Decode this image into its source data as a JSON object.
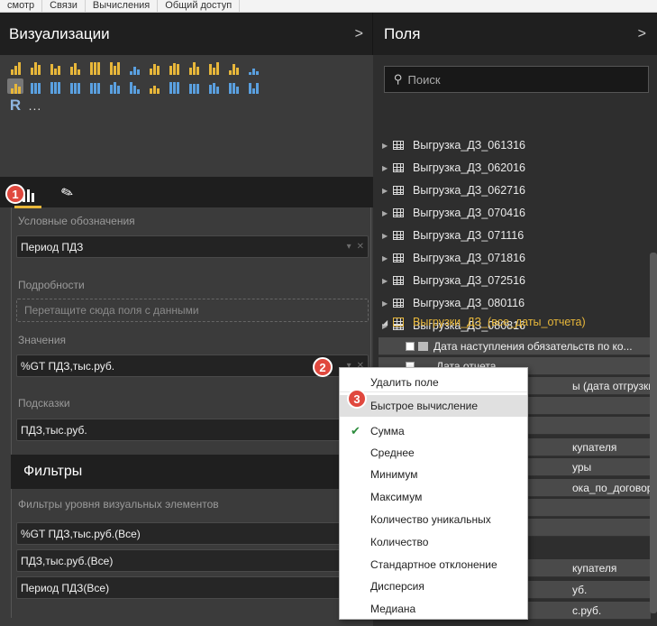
{
  "ribbon": {
    "items": [
      "смотр",
      "Связи",
      "Вычисления",
      "Общий доступ"
    ]
  },
  "viz": {
    "title": "Визуализации",
    "chevron": ">",
    "r_label": "R",
    "more_label": "...",
    "tabs": {
      "fields_badge": "1"
    },
    "wells": {
      "legend_label": "Условные обозначения",
      "legend_value": "Период ПДЗ",
      "details_label": "Подробности",
      "details_placeholder": "Перетащите сюда поля с данными",
      "values_label": "Значения",
      "values_value": "%GT ПДЗ,тыс.руб.",
      "values_badge": "2",
      "tooltips_label": "Подсказки",
      "tooltips_value": "ПДЗ,тыс.руб."
    },
    "filters": {
      "title": "Фильтры",
      "level_label": "Фильтры уровня визуальных элементов",
      "items": [
        "%GT ПДЗ,тыс.руб.(Все)",
        "ПДЗ,тыс.руб.(Все)",
        "Период ПДЗ(Все)"
      ]
    },
    "well_controls": {
      "dropdown": "▾",
      "remove": "✕"
    }
  },
  "fields": {
    "title": "Поля",
    "chevron": ">",
    "search_placeholder": "Поиск",
    "tables": [
      "Выгрузка_ДЗ_061316",
      "Выгрузка_ДЗ_062016",
      "Выгрузка_ДЗ_062716",
      "Выгрузка_ДЗ_070416",
      "Выгрузка_ДЗ_071116",
      "Выгрузка_ДЗ_071816",
      "Выгрузка_ДЗ_072516",
      "Выгрузка_ДЗ_080116",
      "Выгрузка_ДЗ_080816"
    ],
    "open_table": "Выгрузки_ДЗ_(все_даты_отчета)",
    "field_rows": [
      "Дата наступления обязательств по ко...",
      "Дата отчета",
      "ы (дата отгрузки)",
      "",
      "",
      "купателя",
      "уры",
      "ока_по_договору,дн",
      "",
      "",
      "купателя",
      "уб.",
      "с.руб."
    ]
  },
  "context_menu": {
    "items": [
      "Удалить поле",
      "Быстрое вычисление",
      "Сумма",
      "Среднее",
      "Минимум",
      "Максимум",
      "Количество уникальных",
      "Количество",
      "Стандартное отклонение",
      "Дисперсия",
      "Медиана"
    ],
    "quick_calc_badge": "3",
    "checked_item": "Сумма"
  },
  "colors": {
    "accent": "#e8b73a",
    "badge": "#e0483e",
    "panel": "#3b3b3b"
  }
}
